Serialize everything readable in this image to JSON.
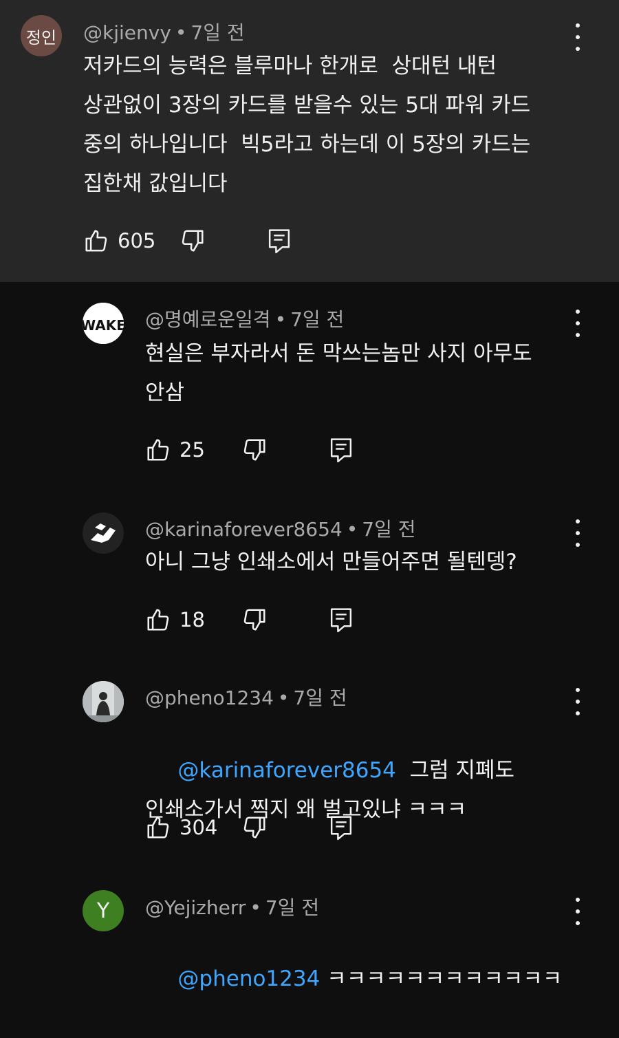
{
  "comments": [
    {
      "avatar_text": "정인",
      "avatar_color": "#6b4a44",
      "author": "@kjienvy",
      "time": "7일 전",
      "text": "저카드의 능력은 블루마나 한개로  상대턴 내턴\n상관없이 3장의 카드를 받을수 있는 5대 파워 카드\n중의 하나입니다  빅5라고 하는데 이 5장의 카드는\n집한채 값입니다",
      "likes": "605"
    }
  ],
  "replies": [
    {
      "avatar_kind": "wake-logo",
      "author": "@명예로운일격",
      "time": "7일 전",
      "text": "현실은 부자라서 돈 막쓰는놈만 사지 아무도\n안삼",
      "likes": "25"
    },
    {
      "avatar_kind": "handshake-logo",
      "author": "@karinaforever8654",
      "time": "7일 전",
      "text": "아니 그냥 인쇄소에서 만들어주면 될텐뎅?",
      "likes": "18"
    },
    {
      "avatar_kind": "photo-person",
      "author": "@pheno1234",
      "time": "7일 전",
      "mention": "@karinaforever8654",
      "text_after_mention": "  그럼 지폐도",
      "text_line2": "인쇄소가서 찍지 왜 벌고있냐 ㅋㅋㅋ",
      "likes": "304"
    },
    {
      "avatar_text": "Y",
      "avatar_color": "#3e7f22",
      "author": "@Yejizherr",
      "time": "7일 전",
      "mention": "@pheno1234",
      "text_after_mention": " ㅋㅋㅋㅋㅋㅋㅋㅋㅋㅋㅋㅋ"
    }
  ],
  "separator": "•",
  "colors": {
    "top_bg": "#272727",
    "page_bg": "#0f0f0f",
    "mention": "#3ea6ff",
    "meta": "#aaaaaa"
  }
}
